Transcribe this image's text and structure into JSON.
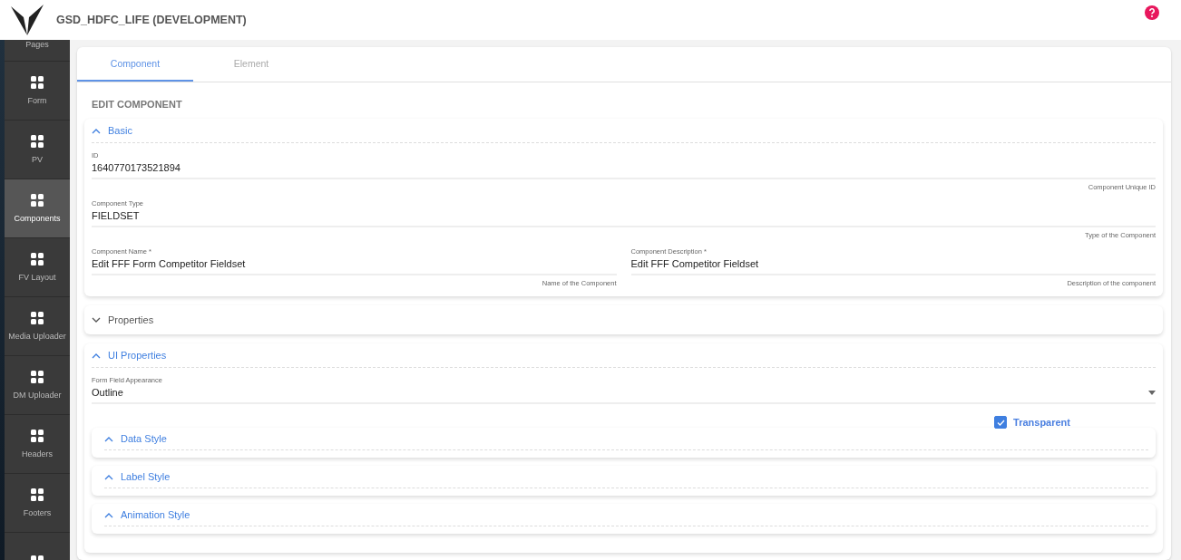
{
  "header": {
    "title": "GSD_HDFC_LIFE (DEVELOPMENT)"
  },
  "sidebar": {
    "items": [
      {
        "label": "Pages",
        "selected": false
      },
      {
        "label": "Form",
        "selected": false
      },
      {
        "label": "PV",
        "selected": false
      },
      {
        "label": "Components",
        "selected": true
      },
      {
        "label": "FV Layout",
        "selected": false
      },
      {
        "label": "Media Uploader",
        "selected": false
      },
      {
        "label": "DM Uploader",
        "selected": false
      },
      {
        "label": "Headers",
        "selected": false
      },
      {
        "label": "Footers",
        "selected": false
      }
    ]
  },
  "tabs": [
    {
      "label": "Component",
      "selected": true
    },
    {
      "label": "Element",
      "selected": false
    }
  ],
  "heading": "EDIT COMPONENT",
  "sections": [
    {
      "title": "Basic",
      "expanded": true,
      "fields": [
        {
          "label": "ID",
          "value": "1640770173521894",
          "hint": "Component Unique ID"
        },
        {
          "label": "Component Type",
          "value": "FIELDSET",
          "hint": "Type of the Component"
        },
        {
          "label": "Component Name *",
          "value": "Edit FFF Form Competitor Fieldset",
          "hint": "Name of the Component",
          "half": true
        },
        {
          "label": "Component Description *",
          "value": "Edit FFF Competitor Fieldset",
          "hint": "Description of the component",
          "half": true
        }
      ]
    },
    {
      "title": "Properties",
      "expanded": false
    },
    {
      "title": "UI Properties",
      "expanded": true,
      "select": {
        "label": "Form Field Appearance",
        "value": "Outline"
      },
      "checkbox": {
        "label": "Transparent",
        "checked": true
      },
      "subsections": [
        {
          "title": "Data Style",
          "expanded": true
        },
        {
          "title": "Label Style",
          "expanded": true
        },
        {
          "title": "Animation Style",
          "expanded": true
        }
      ]
    }
  ]
}
